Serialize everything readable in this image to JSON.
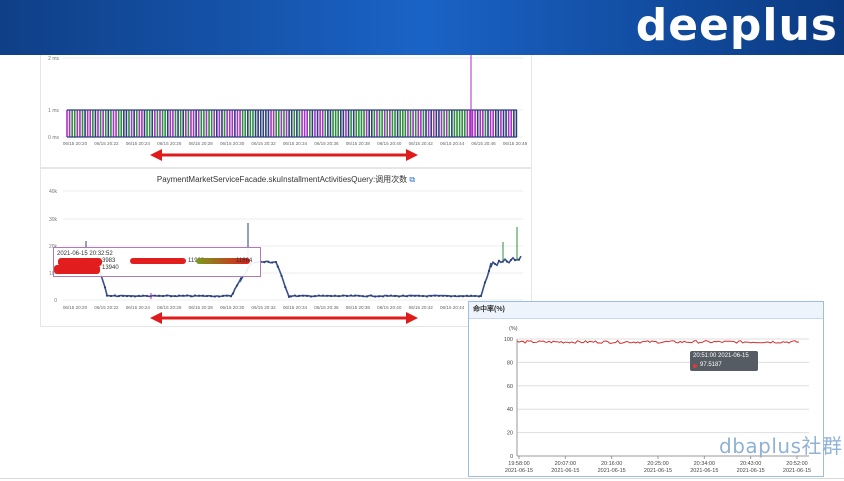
{
  "banner": {
    "logo_text": "deeplus"
  },
  "top_chart": {
    "y_ticks": [
      "2 ms",
      "1 ms",
      "0 ms"
    ],
    "x_ticks": [
      "06/15 20:20",
      "06/15 20:22",
      "06/15 20:24",
      "06/15 20:26",
      "06/15 20:28",
      "06/15 20:30",
      "06/15 20:32",
      "06/15 20:34",
      "06/15 20:36",
      "06/15 20:38",
      "06/15 20:40",
      "06/15 20:42",
      "06/15 20:44",
      "06/15 20:46",
      "06/15 20:48"
    ],
    "series_colors": [
      "#2d8f3c",
      "#a832c4",
      "#2c3f7a"
    ]
  },
  "mid_chart": {
    "title": "PaymentMarketServiceFacade.skuInstallmentActivitiesQuery:调用次数",
    "copy_icon": "copy-icon",
    "y_ticks": [
      "40k",
      "30k",
      "20k",
      "10k",
      "0"
    ],
    "x_ticks": [
      "06/15 20:20",
      "06/15 20:22",
      "06/15 20:24",
      "06/15 20:26",
      "06/15 20:28",
      "06/15 20:30",
      "06/15 20:32",
      "06/15 20:34",
      "06/15 20:36",
      "06/15 20:38",
      "06/15 20:40",
      "06/15 20:42",
      "06/15 20:44",
      "06/15 20:46",
      "06/15 20:48"
    ],
    "tooltip": {
      "time": "2021-06-15 20:32:52",
      "value_a": "3983",
      "value_b": "13940",
      "value_c": "11923",
      "value_d": "11664"
    }
  },
  "cache_chart": {
    "title": "命中率(%)",
    "unit": "(%)",
    "y_ticks": [
      "100",
      "80",
      "60",
      "40",
      "20",
      "0"
    ],
    "x_ticks": [
      {
        "time": "19:58:00",
        "date": "2021-06-15"
      },
      {
        "time": "20:07:00",
        "date": "2021-06-15"
      },
      {
        "time": "20:16:00",
        "date": "2021-06-15"
      },
      {
        "time": "20:25:00",
        "date": "2021-06-15"
      },
      {
        "time": "20:34:00",
        "date": "2021-06-15"
      },
      {
        "time": "20:43:00",
        "date": "2021-06-15"
      },
      {
        "time": "20:52:00",
        "date": "2021-06-15"
      }
    ],
    "tooltip": {
      "time": "20:51:00 2021-06-15",
      "value": "97.5187"
    },
    "line_color": "#d32f2f"
  },
  "arrow_color": "#e01b1b",
  "watermark": "dbaplus社群"
}
